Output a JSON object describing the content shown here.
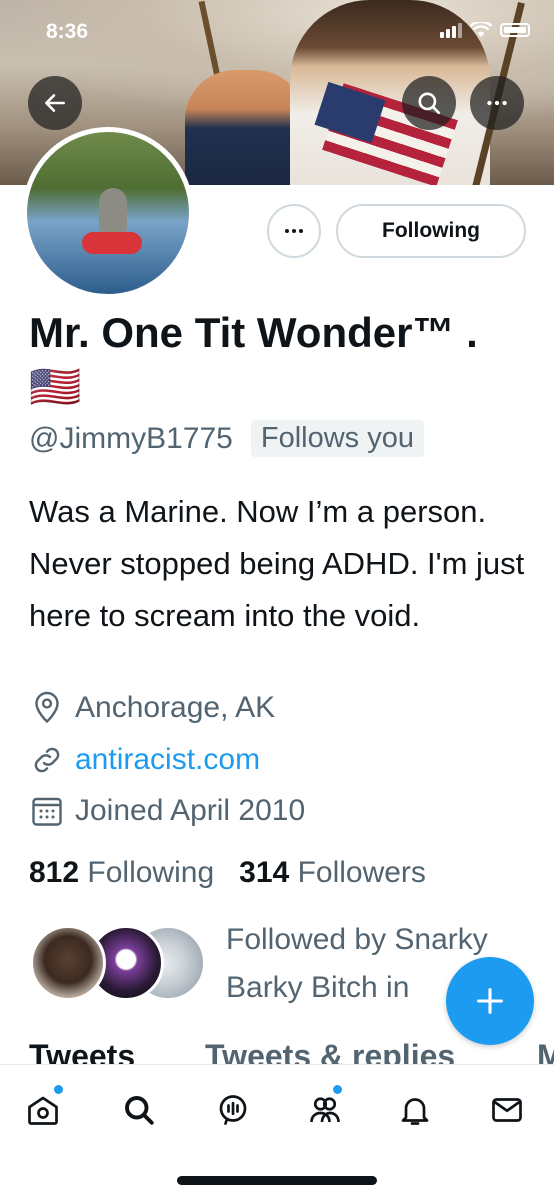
{
  "status_bar": {
    "time": "8:36"
  },
  "header": {
    "back_icon": "arrow-left-icon",
    "search_icon": "search-icon",
    "more_icon": "more-horizontal-icon"
  },
  "profile": {
    "name": "Mr. One Tit Wonder™ . 🇺🇸",
    "handle": "@JimmyB1775",
    "follows_you": "Follows you",
    "bio": "Was a Marine. Now I’m a person. Never stopped being ADHD. I'm just here to scream into the void.",
    "location": "Anchorage, AK",
    "website": "antiracist.com",
    "joined": "Joined April 2010",
    "following_count": "812",
    "following_label": "Following",
    "followers_count": "314",
    "followers_label": "Followers",
    "followed_by": "Followed by Snarky Barky Bitch in"
  },
  "actions": {
    "following_button": "Following",
    "more_button": "more-horizontal-icon"
  },
  "tabs": [
    "Tweets",
    "Tweets & replies",
    "M"
  ],
  "tab_bar": [
    "home-icon",
    "search-icon",
    "spaces-icon",
    "communities-icon",
    "notifications-icon",
    "messages-icon"
  ],
  "colors": {
    "accent": "#1d9bf0",
    "text": "#0f1419",
    "muted": "#536471"
  }
}
